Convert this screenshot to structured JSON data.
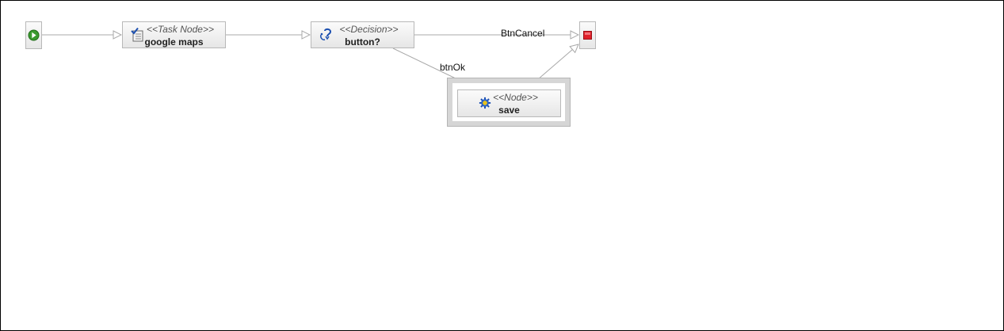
{
  "nodes": {
    "task": {
      "stereotype": "<<Task Node>>",
      "name": "google maps",
      "icon": "task-checklist-icon"
    },
    "decision": {
      "stereotype": "<<Decision>>",
      "name": "button?",
      "icon": "decision-icon"
    },
    "save": {
      "stereotype": "<<Node>>",
      "name": "save",
      "icon": "gear-icon"
    },
    "start": {
      "icon": "start-play-icon"
    },
    "end": {
      "icon": "end-stop-icon"
    }
  },
  "edges": {
    "cancel_label": "BtnCancel",
    "ok_label": "btnOk"
  },
  "colors": {
    "start": "#3a9a2e",
    "end": "#e0202a",
    "edge": "#a8a8a8",
    "node_border": "#b8b8b8"
  }
}
